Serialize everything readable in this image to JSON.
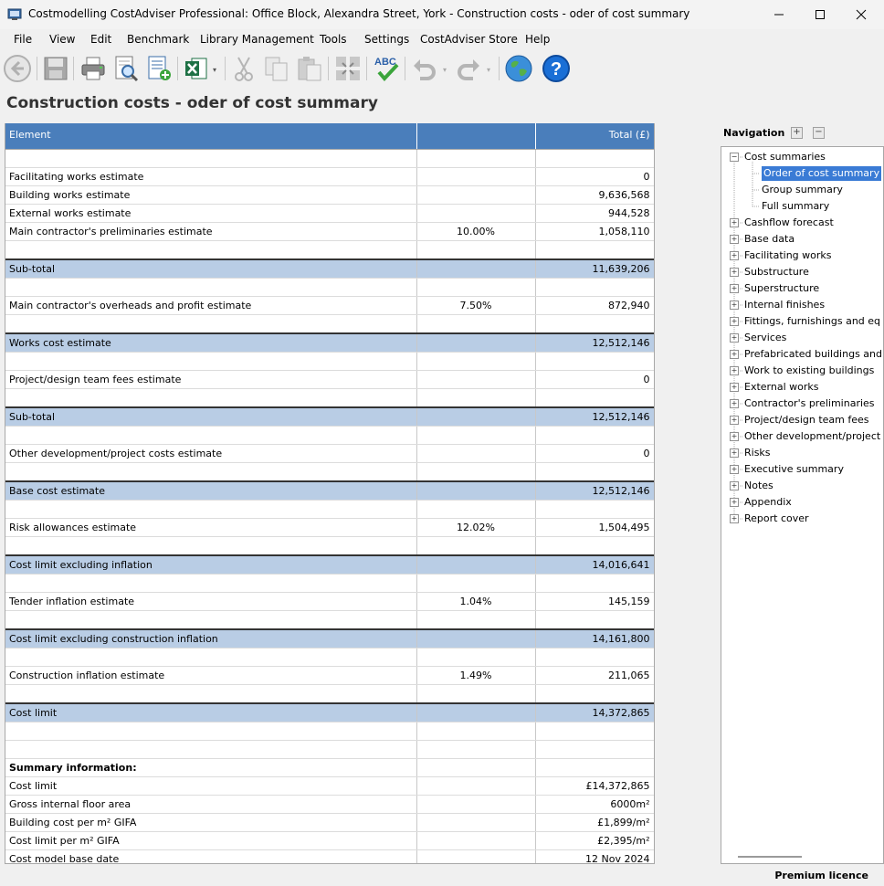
{
  "window": {
    "title": "Costmodelling CostAdviser Professional:  Office Block, Alexandra Street, York  -  Construction costs - oder of cost summary"
  },
  "menu": [
    "File",
    "View",
    "Edit",
    "Benchmark",
    "Library Management",
    "Tools",
    "Settings",
    "CostAdviser Store",
    "Help"
  ],
  "toolbar": {
    "icons": [
      "back-icon",
      "save-icon",
      "print-icon",
      "print-preview-icon",
      "add-report-icon",
      "excel-icon",
      "cut-icon",
      "copy-icon",
      "paste-icon",
      "collapse-icon",
      "spellcheck-icon",
      "undo-icon",
      "redo-icon",
      "web-icon",
      "help-icon"
    ],
    "spell_label": "ABC"
  },
  "page": {
    "title": "Construction costs - oder of cost summary"
  },
  "grid": {
    "columns": [
      "Element",
      "",
      "Total (£)"
    ],
    "rows": [
      {
        "cells": [
          "",
          "",
          ""
        ],
        "style": ""
      },
      {
        "cells": [
          "Facilitating works estimate",
          "",
          "0"
        ],
        "style": ""
      },
      {
        "cells": [
          "Building works estimate",
          "",
          "9,636,568"
        ],
        "style": ""
      },
      {
        "cells": [
          "External works estimate",
          "",
          "944,528"
        ],
        "style": ""
      },
      {
        "cells": [
          "Main contractor's preliminaries estimate",
          "10.00%",
          "1,058,110"
        ],
        "style": ""
      },
      {
        "cells": [
          "",
          "",
          ""
        ],
        "style": ""
      },
      {
        "cells": [
          "Sub-total",
          "",
          "11,639,206"
        ],
        "style": "blue"
      },
      {
        "cells": [
          "",
          "",
          ""
        ],
        "style": ""
      },
      {
        "cells": [
          "Main contractor's overheads and profit estimate",
          "7.50%",
          "872,940"
        ],
        "style": ""
      },
      {
        "cells": [
          "",
          "",
          ""
        ],
        "style": ""
      },
      {
        "cells": [
          "Works cost estimate",
          "",
          "12,512,146"
        ],
        "style": "blue"
      },
      {
        "cells": [
          "",
          "",
          ""
        ],
        "style": ""
      },
      {
        "cells": [
          "Project/design team fees estimate",
          "",
          "0"
        ],
        "style": ""
      },
      {
        "cells": [
          "",
          "",
          ""
        ],
        "style": ""
      },
      {
        "cells": [
          "Sub-total",
          "",
          "12,512,146"
        ],
        "style": "blue"
      },
      {
        "cells": [
          "",
          "",
          ""
        ],
        "style": ""
      },
      {
        "cells": [
          "Other development/project costs estimate",
          "",
          "0"
        ],
        "style": ""
      },
      {
        "cells": [
          "",
          "",
          ""
        ],
        "style": ""
      },
      {
        "cells": [
          "Base cost estimate",
          "",
          "12,512,146"
        ],
        "style": "blue"
      },
      {
        "cells": [
          "",
          "",
          ""
        ],
        "style": ""
      },
      {
        "cells": [
          "Risk allowances estimate",
          "12.02%",
          "1,504,495"
        ],
        "style": ""
      },
      {
        "cells": [
          "",
          "",
          ""
        ],
        "style": ""
      },
      {
        "cells": [
          "Cost limit excluding inflation",
          "",
          "14,016,641"
        ],
        "style": "blue"
      },
      {
        "cells": [
          "",
          "",
          ""
        ],
        "style": ""
      },
      {
        "cells": [
          "Tender inflation estimate",
          "1.04%",
          "145,159"
        ],
        "style": ""
      },
      {
        "cells": [
          "",
          "",
          ""
        ],
        "style": ""
      },
      {
        "cells": [
          "Cost limit excluding construction inflation",
          "",
          "14,161,800"
        ],
        "style": "blue"
      },
      {
        "cells": [
          "",
          "",
          ""
        ],
        "style": ""
      },
      {
        "cells": [
          "Construction inflation estimate",
          "1.49%",
          "211,065"
        ],
        "style": ""
      },
      {
        "cells": [
          "",
          "",
          ""
        ],
        "style": ""
      },
      {
        "cells": [
          "Cost limit",
          "",
          "14,372,865"
        ],
        "style": "blue"
      },
      {
        "cells": [
          "",
          "",
          ""
        ],
        "style": ""
      },
      {
        "cells": [
          "",
          "",
          ""
        ],
        "style": ""
      },
      {
        "cells": [
          "Summary information:",
          "",
          ""
        ],
        "style": "bold"
      },
      {
        "cells": [
          "Cost limit",
          "",
          "£14,372,865"
        ],
        "style": ""
      },
      {
        "cells": [
          "Gross internal floor area",
          "",
          "6000m²"
        ],
        "style": ""
      },
      {
        "cells": [
          "Building cost per m² GIFA",
          "",
          "£1,899/m²"
        ],
        "style": ""
      },
      {
        "cells": [
          "Cost limit per m² GIFA",
          "",
          "£2,395/m²"
        ],
        "style": ""
      },
      {
        "cells": [
          "Cost model base date",
          "",
          "12 Nov 2024"
        ],
        "style": ""
      }
    ]
  },
  "navigation": {
    "label": "Navigation",
    "tree": [
      {
        "label": "Cost summaries",
        "level": 0,
        "expander": "−"
      },
      {
        "label": "Order of cost summary",
        "level": 1,
        "selected": true
      },
      {
        "label": "Group summary",
        "level": 1
      },
      {
        "label": "Full summary",
        "level": 1
      },
      {
        "label": "Cashflow forecast",
        "level": 0,
        "expander": "+"
      },
      {
        "label": "Base data",
        "level": 0,
        "expander": "+"
      },
      {
        "label": "Facilitating works",
        "level": 0,
        "expander": "+"
      },
      {
        "label": "Substructure",
        "level": 0,
        "expander": "+"
      },
      {
        "label": "Superstructure",
        "level": 0,
        "expander": "+"
      },
      {
        "label": "Internal finishes",
        "level": 0,
        "expander": "+"
      },
      {
        "label": "Fittings, furnishings and eq",
        "level": 0,
        "expander": "+"
      },
      {
        "label": "Services",
        "level": 0,
        "expander": "+"
      },
      {
        "label": "Prefabricated buildings and",
        "level": 0,
        "expander": "+"
      },
      {
        "label": "Work to existing buildings",
        "level": 0,
        "expander": "+"
      },
      {
        "label": "External works",
        "level": 0,
        "expander": "+"
      },
      {
        "label": "Contractor's preliminaries",
        "level": 0,
        "expander": "+"
      },
      {
        "label": "Project/design team fees",
        "level": 0,
        "expander": "+"
      },
      {
        "label": "Other development/project",
        "level": 0,
        "expander": "+"
      },
      {
        "label": "Risks",
        "level": 0,
        "expander": "+"
      },
      {
        "label": "Executive summary",
        "level": 0,
        "expander": "+"
      },
      {
        "label": "Notes",
        "level": 0,
        "expander": "+"
      },
      {
        "label": "Appendix",
        "level": 0,
        "expander": "+"
      },
      {
        "label": "Report cover",
        "level": 0,
        "expander": "+"
      }
    ]
  },
  "status": {
    "licence": "Premium licence"
  },
  "colors": {
    "header_blue": "#4a7ebb",
    "total_row_blue": "#b9cde5",
    "selection": "#3a7bd5"
  }
}
